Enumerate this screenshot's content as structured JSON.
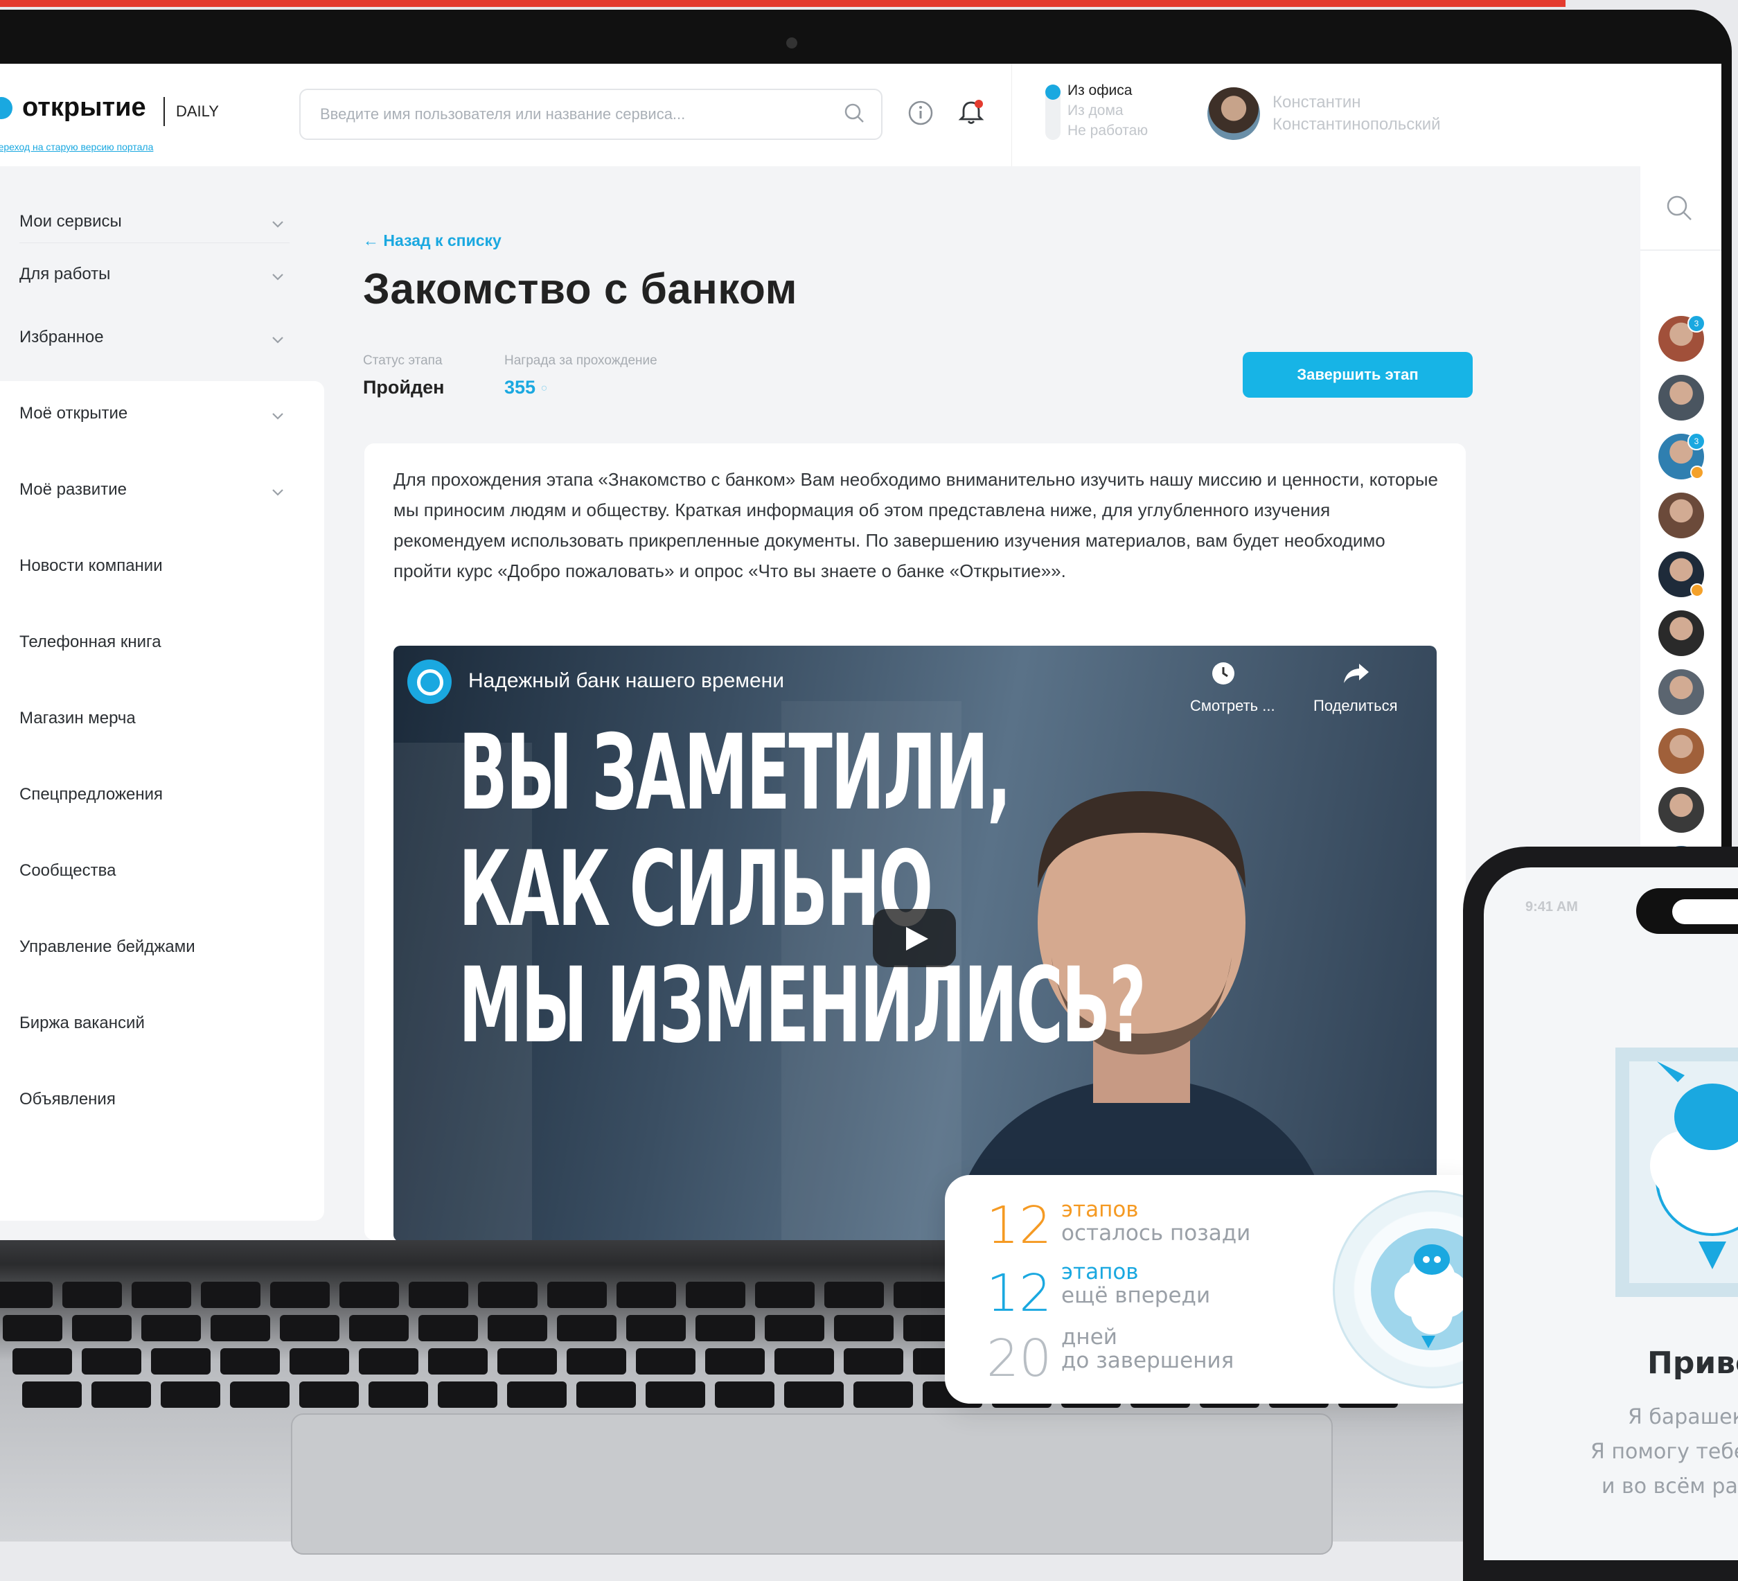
{
  "header": {
    "logo_text": "открытие",
    "logo_suffix": "DAILY",
    "old_version_link": "переход на старую версию портала",
    "search_placeholder": "Введите имя пользователя или название сервиса...",
    "status_options": [
      "Из офиса",
      "Из дома",
      "Не работаю"
    ],
    "user_name_first": "Константин",
    "user_name_last": "Константинопольский"
  },
  "sidebar": {
    "items": [
      {
        "label": "Мои сервисы",
        "chevron": true
      },
      {
        "label": "Для работы",
        "chevron": true
      },
      {
        "label": "Избранное",
        "chevron": true
      },
      {
        "label": "Моё открытие",
        "chevron": true
      },
      {
        "label": "Моё развитие",
        "chevron": true
      },
      {
        "label": "Новости компании",
        "chevron": false
      },
      {
        "label": "Телефонная книга",
        "chevron": false
      },
      {
        "label": "Магазин мерча",
        "chevron": false
      },
      {
        "label": "Спецпредложения",
        "chevron": false
      },
      {
        "label": "Сообщества",
        "chevron": false
      },
      {
        "label": "Управление бейджами",
        "chevron": false
      },
      {
        "label": "Биржа вакансий",
        "chevron": false
      },
      {
        "label": "Объявления",
        "chevron": false
      }
    ]
  },
  "main": {
    "back_link": "← Назад к списку",
    "title": "Закомство с банком",
    "status_label": "Статус этапа",
    "status_value": "Пройден",
    "reward_label": "Награда за прохождение",
    "reward_value": "355",
    "finish_button": "Завершить этап",
    "description": "Для прохождения этапа «Знакомство с банком» Вам необходимо вниманительно изучить нашу миссию и ценности, которые мы приносим людям и обществу. Краткая информация об этом представлена ниже, для углубленного изучения рекомендуем использовать прикрепленные документы. По завершению изучения материалов, вам будет необходимо пройти курс «Добро пожаловать» и опрос «Что вы знаете о банке «Открытие»».",
    "video": {
      "title": "Надежный банк нашего времени",
      "watch_label": "Смотреть ...",
      "share_label": "Поделиться",
      "headline_1": "ВЫ ЗАМЕТИЛИ,",
      "headline_2": "КАК СИЛЬНО",
      "headline_3": "МЫ ИЗМЕНИЛИСЬ?"
    }
  },
  "rail": {
    "avatars": [
      {
        "color": "#a1503a",
        "badge": "3"
      },
      {
        "color": "#4a5560"
      },
      {
        "color": "#2f7fb0",
        "badge": "3",
        "dot": true
      },
      {
        "color": "#6b4a3a"
      },
      {
        "color": "#1e2b3a",
        "dot": true
      },
      {
        "color": "#2a2a2a"
      },
      {
        "color": "#5b6570"
      },
      {
        "color": "#a0603a"
      },
      {
        "color": "#3a3a3a"
      },
      {
        "color": "#2f5a7a"
      }
    ]
  },
  "stats": {
    "done_count": "12",
    "done_unit": "этапов",
    "done_caption": "осталось позади",
    "ahead_count": "12",
    "ahead_unit": "этапов",
    "ahead_caption": "ещё впереди",
    "days_count": "20",
    "days_unit": "дней",
    "days_caption": "до завершения",
    "colors": {
      "done": "#f59a23",
      "ahead": "#1aa8e0",
      "days": "#b8bec4"
    }
  },
  "phone": {
    "time": "9:41 AM",
    "greeting": "Приве",
    "line1": "Я барашек Е",
    "line2": "Я помогу тебе с",
    "line3": "и во всём разо"
  },
  "colors": {
    "accent": "#1aa8e0",
    "alert": "#e43b2f"
  }
}
